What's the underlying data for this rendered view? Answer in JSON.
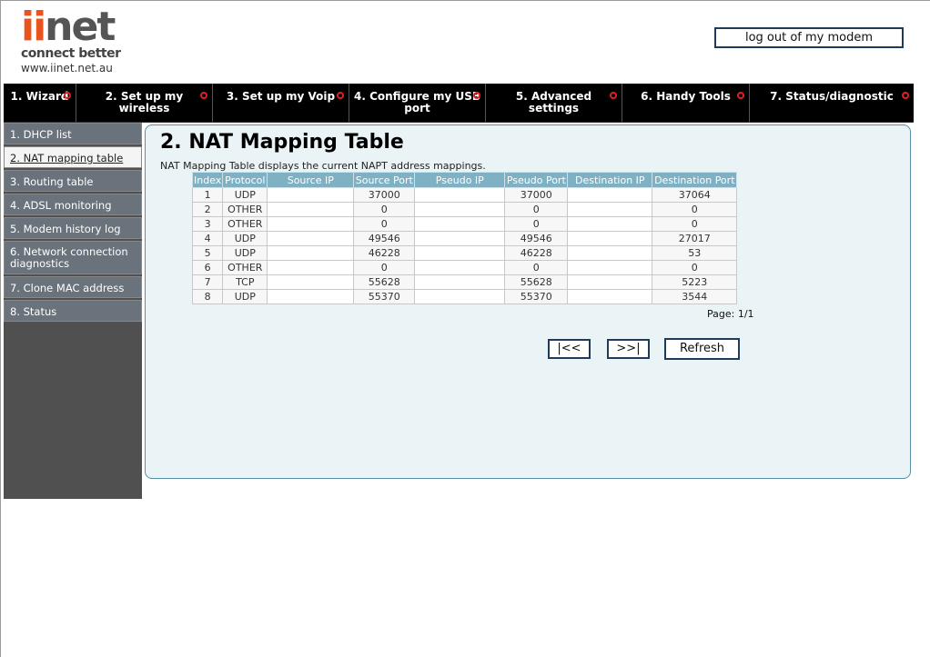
{
  "logo": {
    "ii": "ii",
    "net": "net",
    "tagline": "connect better",
    "url": "www.iinet.net.au"
  },
  "header": {
    "logout_label": "log out of my modem"
  },
  "topnav": [
    {
      "line1": "1. Wizard",
      "line2": ""
    },
    {
      "line1": "2. Set up my",
      "line2": "wireless"
    },
    {
      "line1": "3. Set up my Voip",
      "line2": ""
    },
    {
      "line1": "4. Configure my USB",
      "line2": "port"
    },
    {
      "line1": "5. Advanced",
      "line2": "settings"
    },
    {
      "line1": "6. Handy Tools",
      "line2": ""
    },
    {
      "line1": "7. Status/diagnostic",
      "line2": ""
    }
  ],
  "sidebar": [
    {
      "line1": "1. DHCP list",
      "line2": ""
    },
    {
      "line1": "2. NAT mapping table",
      "line2": ""
    },
    {
      "line1": "3. Routing table",
      "line2": ""
    },
    {
      "line1": "4. ADSL monitoring",
      "line2": ""
    },
    {
      "line1": "5. Modem history log",
      "line2": ""
    },
    {
      "line1": "6. Network connection",
      "line2": "diagnostics"
    },
    {
      "line1": "7. Clone MAC address",
      "line2": ""
    },
    {
      "line1": "8. Status",
      "line2": ""
    }
  ],
  "main": {
    "title": "2. NAT Mapping Table",
    "description": "NAT Mapping Table displays the current NAPT address mappings.",
    "table": {
      "headers": [
        "Index",
        "Protocol",
        "Source IP",
        "Source Port",
        "Pseudo IP",
        "Pseudo Port",
        "Destination IP",
        "Destination Port"
      ],
      "rows": [
        [
          "1",
          "UDP",
          "",
          "37000",
          "",
          "37000",
          "",
          "37064"
        ],
        [
          "2",
          "OTHER",
          "",
          "0",
          "",
          "0",
          "",
          "0"
        ],
        [
          "3",
          "OTHER",
          "",
          "0",
          "",
          "0",
          "",
          "0"
        ],
        [
          "4",
          "UDP",
          "",
          "49546",
          "",
          "49546",
          "",
          "27017"
        ],
        [
          "5",
          "UDP",
          "",
          "46228",
          "",
          "46228",
          "",
          "53"
        ],
        [
          "6",
          "OTHER",
          "",
          "0",
          "",
          "0",
          "",
          "0"
        ],
        [
          "7",
          "TCP",
          "",
          "55628",
          "",
          "55628",
          "",
          "5223"
        ],
        [
          "8",
          "UDP",
          "",
          "55370",
          "",
          "55370",
          "",
          "3544"
        ]
      ]
    },
    "page_label": "Page: 1/1",
    "buttons": {
      "first": "|<<",
      "next": ">>|",
      "refresh": "Refresh"
    }
  },
  "colors": {
    "accent": "#e8541c",
    "nav_bg": "#000000",
    "header_cell": "#7fb1c5",
    "panel_border": "#5a8fa8"
  }
}
